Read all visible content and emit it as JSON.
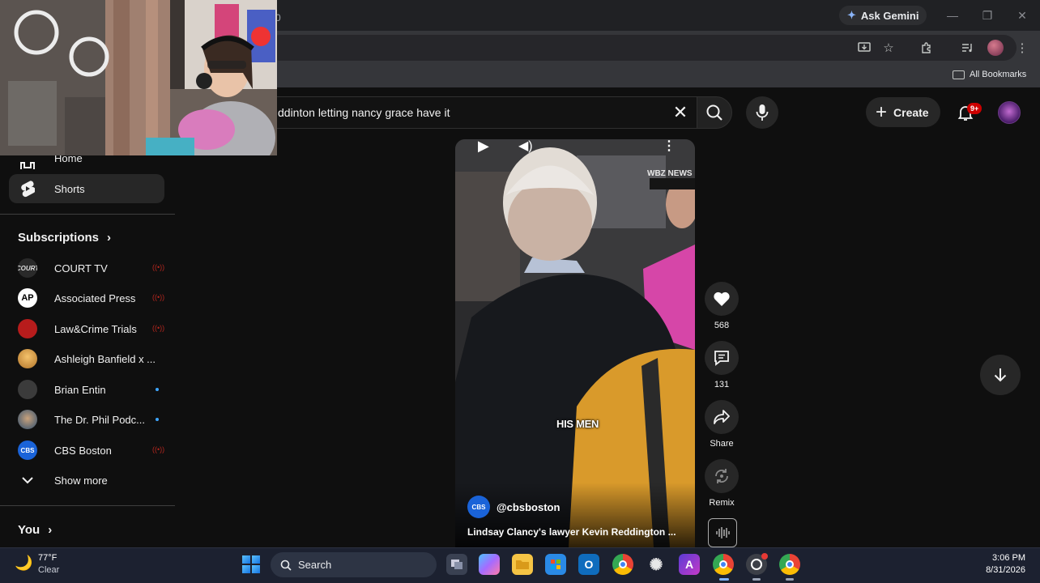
{
  "browser": {
    "ask_gemini_label": "Ask Gemini",
    "omnibox_fragment": "0",
    "all_bookmarks_label": "All Bookmarks"
  },
  "youtube": {
    "search_query": "ddinton letting nancy grace have it",
    "create_label": "Create",
    "notification_count": "9+"
  },
  "sidebar": {
    "home_label": "Home",
    "shorts_label": "Shorts",
    "subscriptions_heading": "Subscriptions",
    "subscriptions": [
      {
        "name": "COURT TV",
        "indicator": "live",
        "avatar_text": "COURT"
      },
      {
        "name": "Associated Press",
        "indicator": "live",
        "avatar_text": "AP"
      },
      {
        "name": "Law&Crime Trials",
        "indicator": "live",
        "avatar_text": ""
      },
      {
        "name": "Ashleigh Banfield x ...",
        "indicator": "none",
        "avatar_text": ""
      },
      {
        "name": "Brian Entin",
        "indicator": "new",
        "avatar_text": ""
      },
      {
        "name": "The Dr. Phil Podc...",
        "indicator": "new",
        "avatar_text": ""
      },
      {
        "name": "CBS Boston",
        "indicator": "live",
        "avatar_text": "CBS"
      }
    ],
    "show_more_label": "Show more",
    "you_heading": "You"
  },
  "short": {
    "caption": "HIS MEN",
    "channel_handle": "@cbsboston",
    "channel_logo_text": "CBS",
    "title": "Lindsay Clancy's lawyer Kevin Reddington ...",
    "watermark": "WBZ NEWS",
    "likes": "568",
    "comments": "131",
    "share_label": "Share",
    "remix_label": "Remix"
  },
  "taskbar": {
    "temperature": "77°F",
    "condition": "Clear",
    "search_label": "Search",
    "time": "3:06 PM",
    "date": "8/31/2026"
  },
  "colors": {
    "background": "#0f0f0f",
    "live_red": "#b3261e",
    "new_blue": "#3ea6ff",
    "notification_red": "#cc0000"
  }
}
